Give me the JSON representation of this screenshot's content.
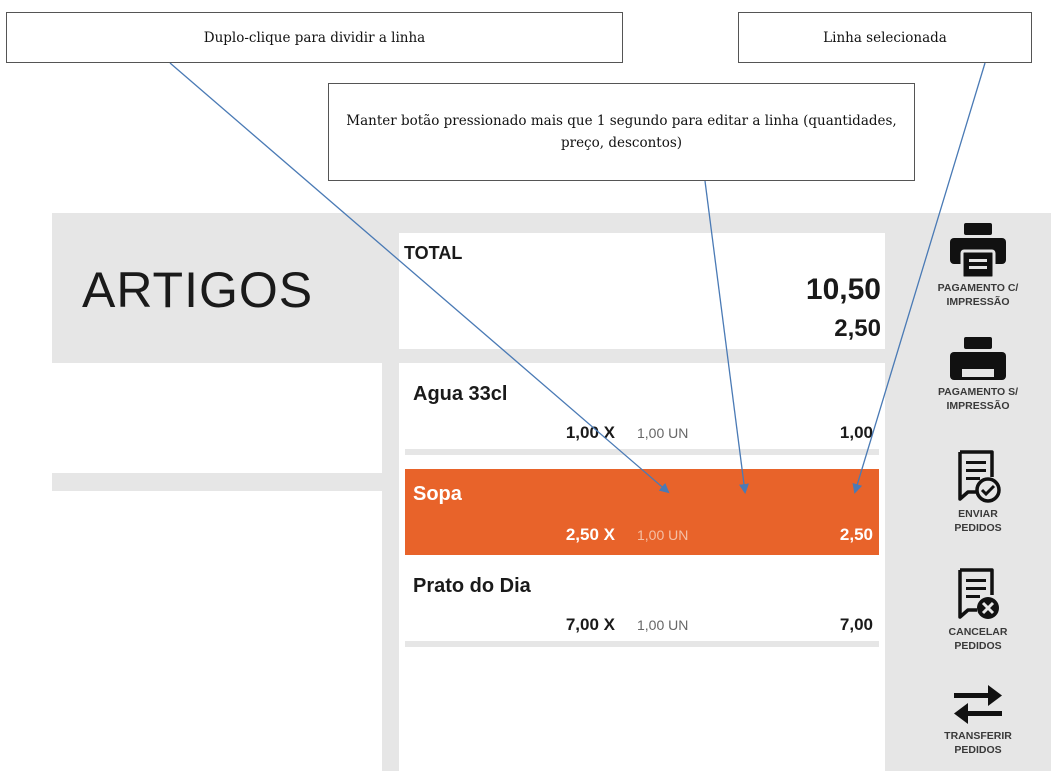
{
  "header": {
    "title": "ARTIGOS"
  },
  "total": {
    "label": "TOTAL",
    "value": "10,50",
    "secondary": "2,50"
  },
  "order_lines": [
    {
      "name": "Agua 33cl",
      "price": "1,00 X",
      "quantity": "1,00 UN",
      "amount": "1,00",
      "selected": false
    },
    {
      "name": "Sopa",
      "price": "2,50 X",
      "quantity": "1,00 UN",
      "amount": "2,50",
      "selected": true
    },
    {
      "name": "Prato do Dia",
      "price": "7,00 X",
      "quantity": "1,00 UN",
      "amount": "7,00",
      "selected": false
    }
  ],
  "actions": [
    {
      "label_line1": "PAGAMENTO C/",
      "label_line2": "IMPRESSÃO",
      "icon": "printer-icon"
    },
    {
      "label_line1": "PAGAMENTO S/",
      "label_line2": "IMPRESSÃO",
      "icon": "printer-icon"
    },
    {
      "label_line1": "ENVIAR",
      "label_line2": "PEDIDOS",
      "icon": "send-orders-icon"
    },
    {
      "label_line1": "CANCELAR",
      "label_line2": "PEDIDOS",
      "icon": "cancel-orders-icon"
    },
    {
      "label_line1": "TRANSFERIR",
      "label_line2": "PEDIDOS",
      "icon": "transfer-icon"
    }
  ],
  "callouts": {
    "split_line": "Duplo-clique para dividir a linha",
    "selected_line": "Linha selecionada",
    "edit_line": "Manter botão pressionado mais que 1 segundo para editar a linha (quantidades, preço, descontos)"
  },
  "colors": {
    "selected_line": "#e8632a",
    "background": "#e6e6e6",
    "arrow": "#4a7ab5"
  }
}
